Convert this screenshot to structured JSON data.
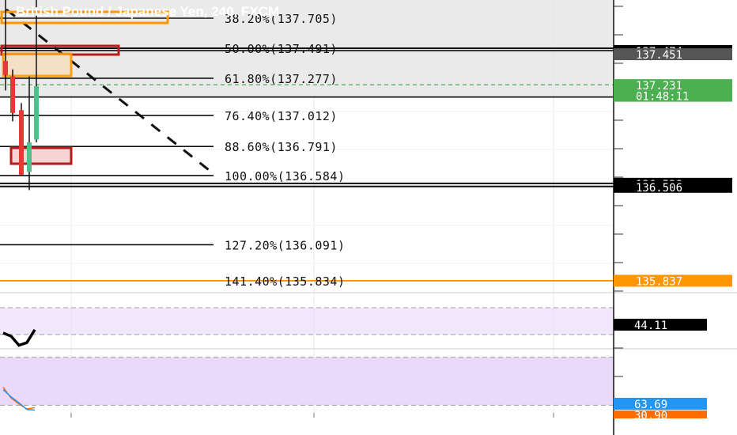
{
  "title": "British Pound / Japanese Yen, 240, FXCM",
  "colors": {
    "fib_zone": "#e6e6e6",
    "bull": "#4fbf8c",
    "bear": "#e53935",
    "orange": "#ff9800",
    "dark_red": "#b71c1c",
    "price_tag_green": "#4caf50",
    "osc_fill": "#ead9fb",
    "osc_line_blue": "#2196f3",
    "osc_line_orange": "#ff6d00"
  },
  "chart_data": [
    {
      "type": "candlestick",
      "title": "British Pound / Japanese Yen, 240, FXCM",
      "ylim": [
        135.76,
        137.92
      ],
      "fib_levels": [
        {
          "label": "38.20%(137.705)",
          "value": 137.705
        },
        {
          "label": "50.00%(137.491)",
          "value": 137.491
        },
        {
          "label": "61.80%(137.277)",
          "value": 137.277
        },
        {
          "label": "76.40%(137.012)",
          "value": 137.012
        },
        {
          "label": "88.60%(136.791)",
          "value": 136.791
        },
        {
          "label": "100.00%(136.584)",
          "value": 136.584
        },
        {
          "label": "127.20%(136.091)",
          "value": 136.091
        },
        {
          "label": "141.40%(135.834)",
          "value": 135.834
        }
      ],
      "price_tags": [
        {
          "text": "137.474",
          "value": 137.474,
          "style": "black"
        },
        {
          "text": "137.451",
          "value": 137.451,
          "style": "gray"
        },
        {
          "text": "137.231",
          "value": 137.231,
          "style": "green"
        },
        {
          "text": "01:48:11",
          "value": 137.155,
          "style": "green"
        },
        {
          "text": "136.528",
          "value": 136.528,
          "style": "black"
        },
        {
          "text": "136.506",
          "value": 136.506,
          "style": "black"
        },
        {
          "text": "135.837",
          "value": 135.837,
          "style": "orange"
        }
      ],
      "candles": [
        {
          "open": 137.4,
          "high": 137.92,
          "low": 137.19,
          "close": 137.3
        },
        {
          "open": 137.29,
          "high": 137.34,
          "low": 136.97,
          "close": 137.03
        },
        {
          "open": 137.05,
          "high": 137.1,
          "low": 136.58,
          "close": 136.59
        },
        {
          "open": 136.61,
          "high": 137.29,
          "low": 136.48,
          "close": 136.82
        },
        {
          "open": 136.84,
          "high": 137.92,
          "low": 136.82,
          "close": 137.22
        }
      ]
    },
    {
      "type": "line",
      "indicator": "oscillator_1",
      "value_tag": "44.11",
      "ylim": [
        0,
        100
      ],
      "band": [
        25,
        75
      ],
      "series": [
        {
          "values": [
            28,
            22,
            5,
            10,
            34
          ]
        }
      ]
    },
    {
      "type": "line",
      "indicator": "oscillator_2",
      "value_tags": [
        "63.69",
        "30.90"
      ],
      "ylim": [
        0,
        100
      ],
      "band": [
        10,
        90
      ],
      "series": [
        {
          "values": [
            40,
            22,
            12,
            4,
            6
          ]
        },
        {
          "values": [
            36,
            24,
            14,
            3,
            2
          ]
        }
      ]
    }
  ]
}
